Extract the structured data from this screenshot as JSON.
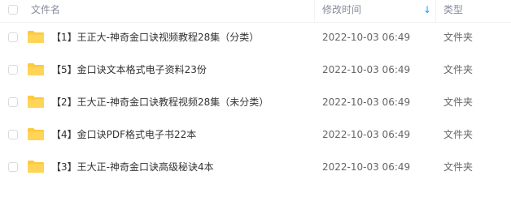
{
  "header": {
    "name_label": "文件名",
    "time_label": "修改时间",
    "sort_arrow": "↓",
    "type_label": "类型",
    "accent_color": "#06a7ff"
  },
  "folder_icon": {
    "name": "folder-icon",
    "color": "#ffc93d"
  },
  "files": [
    {
      "name": "【1】王正大-神奇金口诀视频教程28集（分类）",
      "time": "2022-10-03 06:49",
      "type": "文件夹"
    },
    {
      "name": "【5】金口诀文本格式电子资料23份",
      "time": "2022-10-03 06:49",
      "type": "文件夹"
    },
    {
      "name": "【2】王大正-神奇金口诀教程视频28集（未分类）",
      "time": "2022-10-03 06:49",
      "type": "文件夹"
    },
    {
      "name": "【4】金口诀PDF格式电子书22本",
      "time": "2022-10-03 06:49",
      "type": "文件夹"
    },
    {
      "name": "【3】王大正-神奇金口诀高级秘诀4本",
      "time": "2022-10-03 06:49",
      "type": "文件夹"
    }
  ]
}
